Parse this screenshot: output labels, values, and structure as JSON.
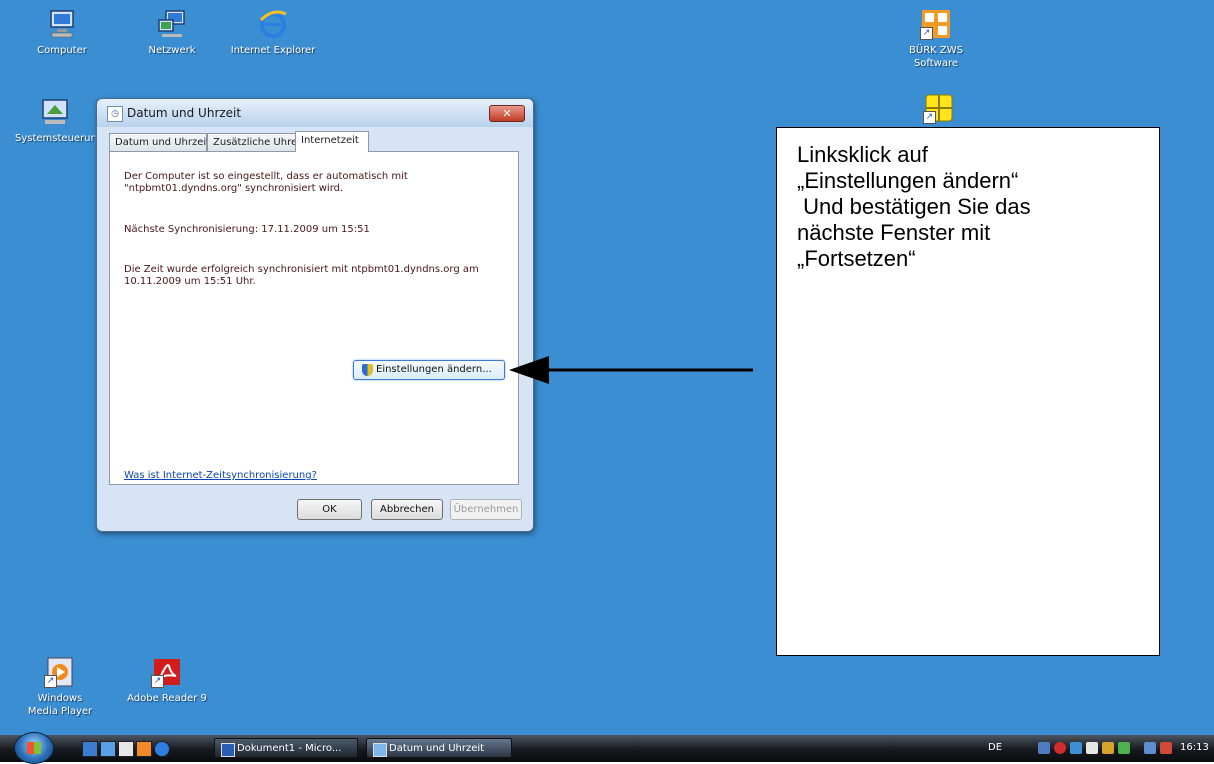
{
  "desktop": {
    "icons": [
      {
        "label": "Computer"
      },
      {
        "label": "Netzwerk"
      },
      {
        "label": "Internet Explorer"
      },
      {
        "label": "BÜRK ZWS Software"
      },
      {
        "label": "Systemsteuerung"
      },
      {
        "label": "Windows Media Player"
      },
      {
        "label": "Adobe Reader 9"
      }
    ]
  },
  "dialog": {
    "title": "Datum und Uhrzeit",
    "close_symbol": "✕",
    "tabs": [
      {
        "label": "Datum und Uhrzeit"
      },
      {
        "label": "Zusätzliche Uhren"
      },
      {
        "label": "Internetzeit"
      }
    ],
    "active_tab": "Internetzeit",
    "text_auto_line1": "Der Computer ist so eingestellt, dass er automatisch mit",
    "text_auto_line2": "\"ntpbmt01.dyndns.org\" synchronisiert wird.",
    "text_next_sync": "Nächste Synchronisierung: 17.11.2009 um 15:51",
    "text_success_line1": "Die Zeit wurde erfolgreich synchronisiert mit ntpbmt01.dyndns.org am",
    "text_success_line2": "10.11.2009 um 15:51 Uhr.",
    "change_settings_label": "Einstellungen ändern...",
    "help_link": "Was ist Internet-Zeitsynchronisierung?",
    "ok_label": "OK",
    "cancel_label": "Abbrechen",
    "apply_label": "Übernehmen"
  },
  "annotation": {
    "lines": [
      "Linksklick auf",
      "„Einstellungen ändern“",
      " Und bestätigen Sie das",
      "nächste Fenster mit",
      "„Fortsetzen“"
    ]
  },
  "taskbar": {
    "tasks": [
      {
        "label": "Dokument1 - Micro..."
      },
      {
        "label": "Datum und Uhrzeit"
      }
    ],
    "language": "DE",
    "clock": "16:13"
  },
  "colors": {
    "desktop": "#3b8ed2",
    "link": "#0a45b4",
    "dialog_text": "#4a1616"
  }
}
